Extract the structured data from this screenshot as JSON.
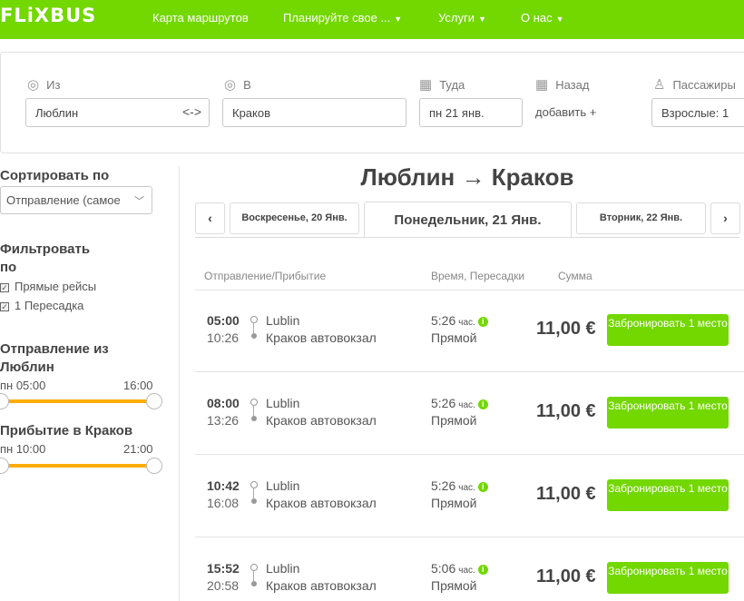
{
  "nav": {
    "logo": "FLiXBUS",
    "links": [
      "Карта маршрутов",
      "Планируйте свое ...",
      "Услуги",
      "О нас"
    ],
    "brand_color": "#73d700"
  },
  "search": {
    "from_label": "Из",
    "from_value": "Люблин",
    "to_label": "В",
    "to_value": "Краков",
    "depart_label": "Туда",
    "depart_value": "пн 21 янв.",
    "return_label": "Назад",
    "return_add": "добавить +",
    "pax_label": "Пассажиры",
    "pax_value": "Взрослые: 1"
  },
  "sidebar": {
    "sort_title": "Сортировать по",
    "sort_value": "Отправление (самое",
    "filter_title_1": "Фильтровать",
    "filter_title_2": "по",
    "filters": [
      "Прямые рейсы",
      "1 Пересадка"
    ],
    "departure_title_1": "Отправление из",
    "departure_title_2": "Люблин",
    "dep_min": "пн 05:00",
    "dep_max": "16:00",
    "arrival_title": "Прибытие в Краков",
    "arr_min": "пн 10:00",
    "arr_max": "21:00",
    "slider_color": "#ffad00"
  },
  "main": {
    "route_title": "Люблин → Краков",
    "prev_icon": "‹",
    "next_icon": "›",
    "tab_prev": "Воскресенье, 20 Янв.",
    "tab_active": "Понедельник, 21 Янв.",
    "tab_next": "Вторник, 22 Янв.",
    "col_route": "Отправление/Прибытие",
    "col_time": "Время, Пересадки",
    "col_sum": "Сумма"
  },
  "trips": [
    {
      "dep": "05:00",
      "arr": "10:26",
      "from": "Lublin",
      "to": "Краков автовокзал",
      "dur": "5:26",
      "unit": "час.",
      "type": "Прямой",
      "price": "11,00 €",
      "button": "Забронировать 1 место"
    },
    {
      "dep": "08:00",
      "arr": "13:26",
      "from": "Lublin",
      "to": "Краков автовокзал",
      "dur": "5:26",
      "unit": "час.",
      "type": "Прямой",
      "price": "11,00 €",
      "button": "Забронировать 1 место"
    },
    {
      "dep": "10:42",
      "arr": "16:08",
      "from": "Lublin",
      "to": "Краков автовокзал",
      "dur": "5:26",
      "unit": "час.",
      "type": "Прямой",
      "price": "11,00 €",
      "button": "Забронировать 1 место"
    },
    {
      "dep": "15:52",
      "arr": "20:58",
      "from": "Lublin",
      "to": "Краков автовокзал",
      "dur": "5:06",
      "unit": "час.",
      "type": "Прямой",
      "price": "11,00 €",
      "button": "Забронировать 1 место"
    }
  ]
}
